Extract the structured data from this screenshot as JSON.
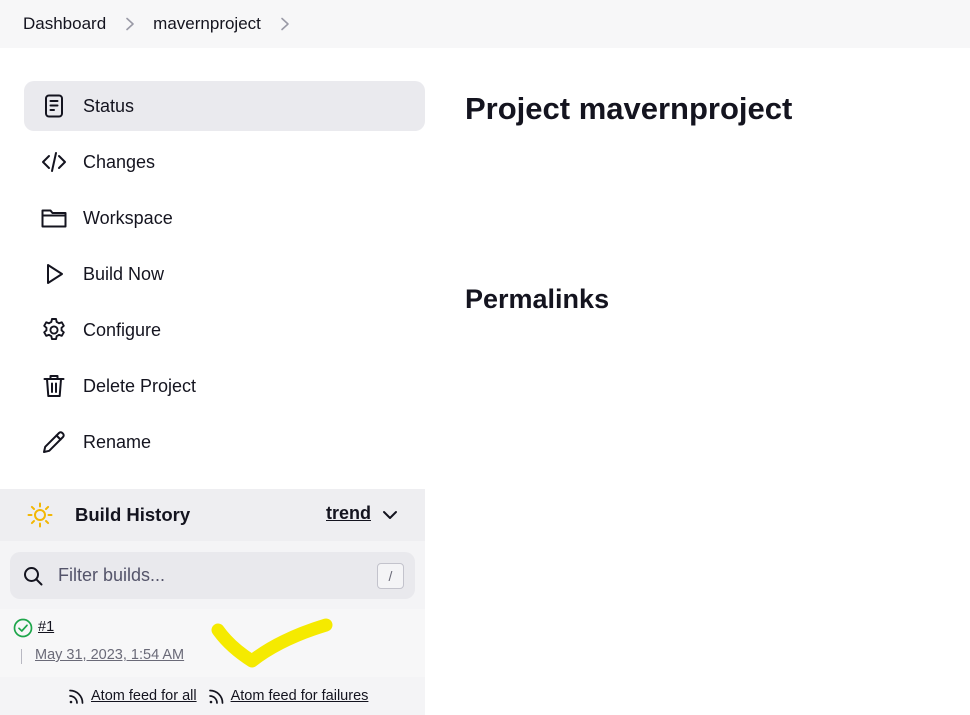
{
  "breadcrumb": {
    "items": [
      {
        "label": "Dashboard"
      },
      {
        "label": "mavernproject"
      }
    ]
  },
  "sidebar": {
    "items": [
      {
        "label": "Status",
        "icon": "document-icon",
        "active": true
      },
      {
        "label": "Changes",
        "icon": "code-icon"
      },
      {
        "label": "Workspace",
        "icon": "folder-icon"
      },
      {
        "label": "Build Now",
        "icon": "play-icon"
      },
      {
        "label": "Configure",
        "icon": "gear-icon"
      },
      {
        "label": "Delete Project",
        "icon": "trash-icon"
      },
      {
        "label": "Rename",
        "icon": "pencil-icon"
      }
    ]
  },
  "build_history": {
    "title": "Build History",
    "trend_label": "trend",
    "filter_placeholder": "Filter builds...",
    "shortcut_hint": "/",
    "builds": [
      {
        "number": "#1",
        "date": "May 31, 2023, 1:54 AM",
        "status": "success"
      }
    ],
    "feeds": {
      "all": "Atom feed for all",
      "failures": "Atom feed for failures"
    }
  },
  "main": {
    "title": "Project mavernproject",
    "permalinks_heading": "Permalinks"
  },
  "colors": {
    "success": "#1ea64b",
    "highlight": "#f5ea00",
    "sun": "#f2b705"
  }
}
